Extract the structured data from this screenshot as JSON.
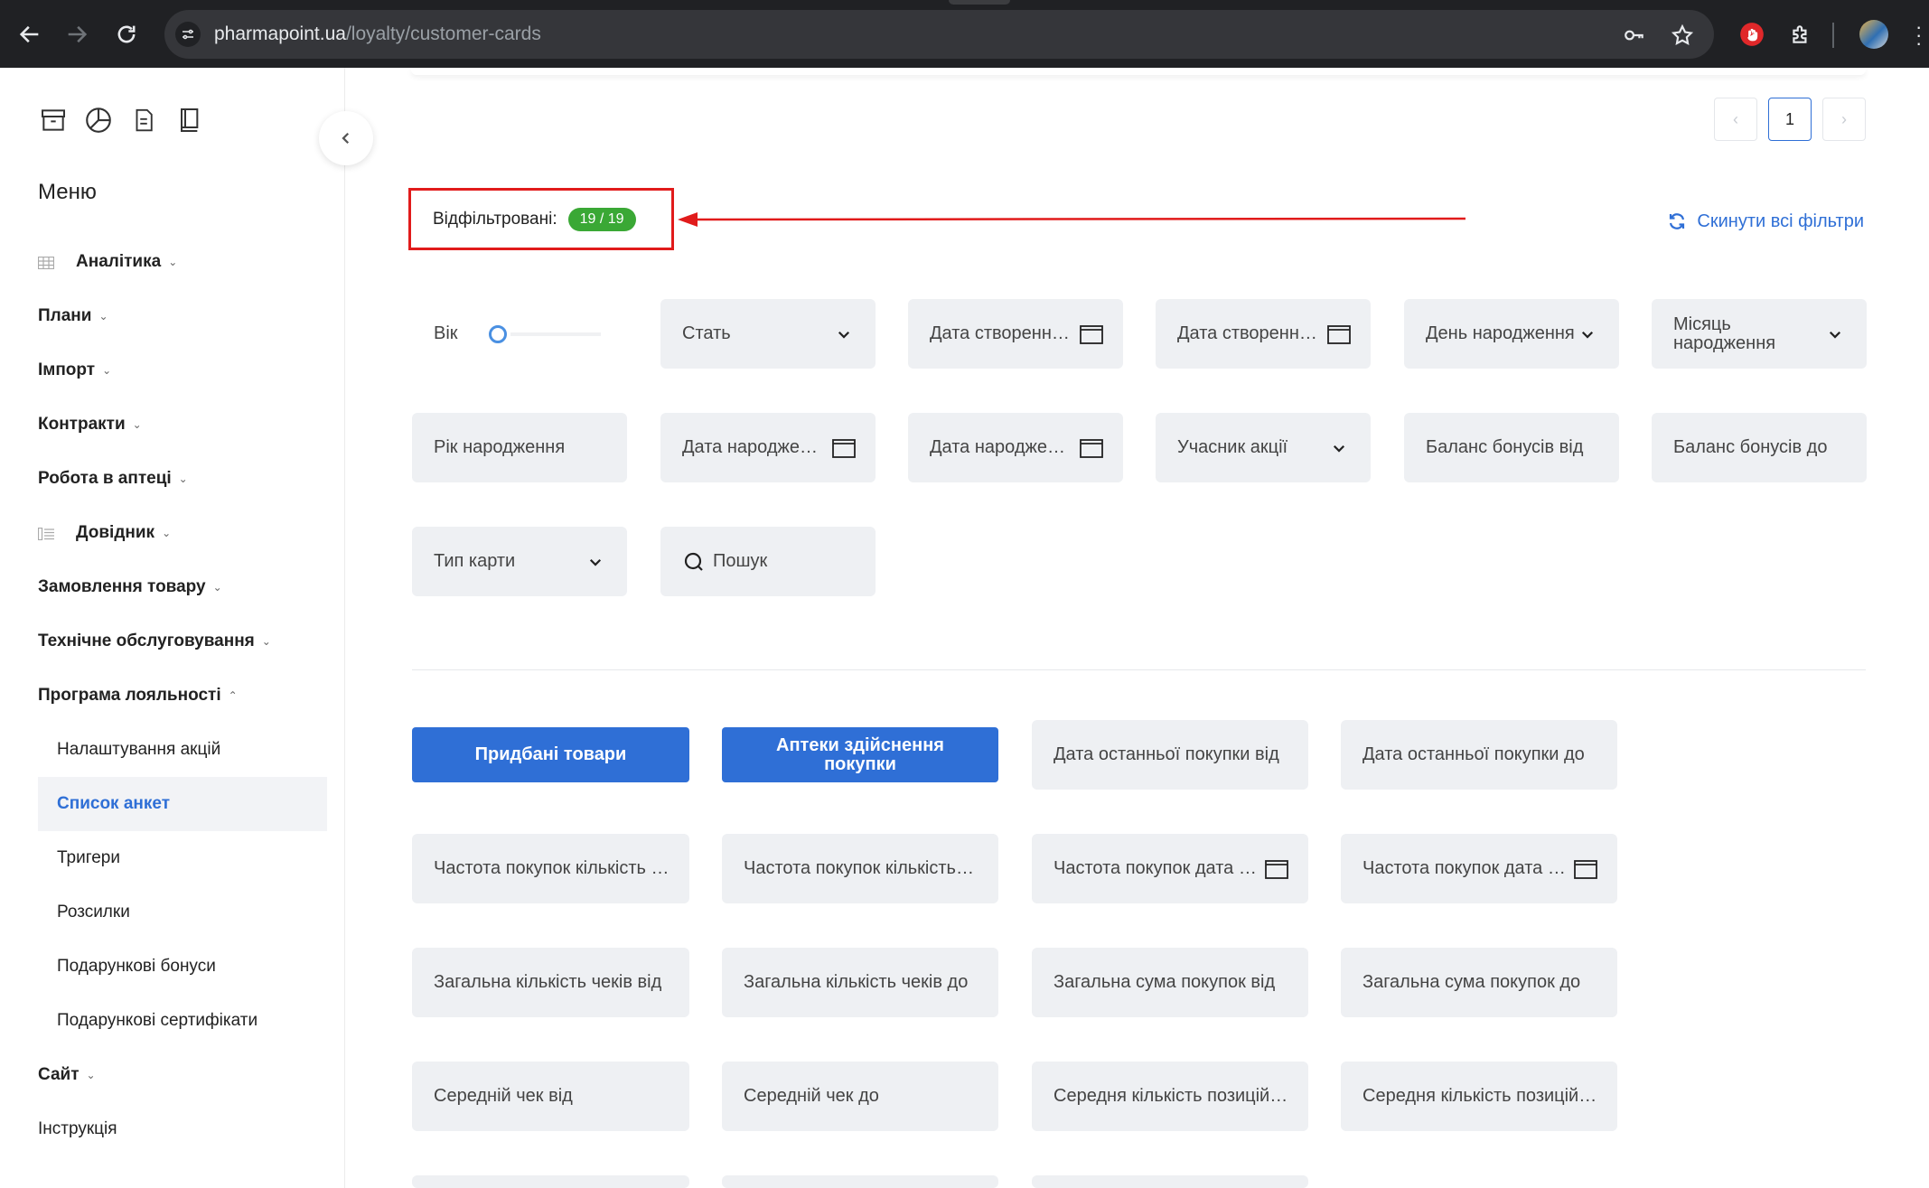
{
  "browser": {
    "url_host": "pharmapoint.ua",
    "url_path": "/loyalty/customer-cards"
  },
  "sidebar": {
    "menu_title": "Меню",
    "items": [
      {
        "label": "Аналітика",
        "icon": "grid-icon",
        "chevron": "⌄"
      },
      {
        "label": "Плани",
        "chevron": "⌄"
      },
      {
        "label": "Імпорт",
        "chevron": "⌄"
      },
      {
        "label": "Контракти",
        "chevron": "⌄"
      },
      {
        "label": "Робота в аптеці",
        "chevron": "⌄"
      },
      {
        "label": "Довідник",
        "icon": "list-icon",
        "chevron": "⌄"
      },
      {
        "label": "Замовлення товару",
        "chevron": "⌄"
      },
      {
        "label": "Технічне обслуговування",
        "chevron": "⌄"
      },
      {
        "label": "Програма лояльності",
        "chevron": "⌃"
      }
    ],
    "subitems": [
      {
        "label": "Налаштування акцій"
      },
      {
        "label": "Список анкет"
      },
      {
        "label": "Тригери"
      },
      {
        "label": "Розсилки"
      },
      {
        "label": "Подарункові бонуси"
      },
      {
        "label": "Подарункові сертифікати"
      }
    ],
    "tail_items": [
      {
        "label": "Сайт",
        "chevron": "⌄"
      },
      {
        "label": "Інструкція"
      }
    ]
  },
  "pagination": {
    "current": "1",
    "prev": "‹",
    "next": "›"
  },
  "filters_summary": {
    "label": "Відфільтровані:",
    "count": "19 / 19",
    "reset_label": "Скинути всі фільтри"
  },
  "filters": {
    "age": "Вік",
    "gender": "Стать",
    "created_from": "Дата створення від",
    "created_to": "Дата створення до",
    "birth_day": "День народження",
    "birth_month": "Місяць народження",
    "birth_year": "Рік народження",
    "birth_date_from": "Дата народження від",
    "birth_date_to": "Дата народження до",
    "promo_member": "Учасник акції",
    "bonus_from": "Баланс бонусів від",
    "bonus_to": "Баланс бонусів до",
    "card_type": "Тип карти",
    "search_placeholder": "Пошук"
  },
  "purchase_filters": {
    "bought_goods": "Придбані товари",
    "purchase_pharmacies": "Аптеки здійснення покупки",
    "last_purchase_from": "Дата останньої покупки від",
    "last_purchase_to": "Дата останньої покупки до",
    "freq_count_from": "Частота покупок кількість від",
    "freq_count_to": "Частота покупок кількість до",
    "freq_date_from": "Частота покупок дата від",
    "freq_date_to": "Частота покупок дата до",
    "checks_total_from": "Загальна кількість чеків від",
    "checks_total_to": "Загальна кількість чеків до",
    "sum_total_from": "Загальна сума покупок від",
    "sum_total_to": "Загальна сума покупок до",
    "avg_check_from": "Середній чек від",
    "avg_check_to": "Середній чек до",
    "avg_positions_from": "Середня кількість позицій від",
    "avg_positions_to": "Середня кількість позицій до"
  },
  "colors": {
    "accent": "#2f6fd6",
    "badge": "#3aa835",
    "highlight": "#e11b1b"
  }
}
